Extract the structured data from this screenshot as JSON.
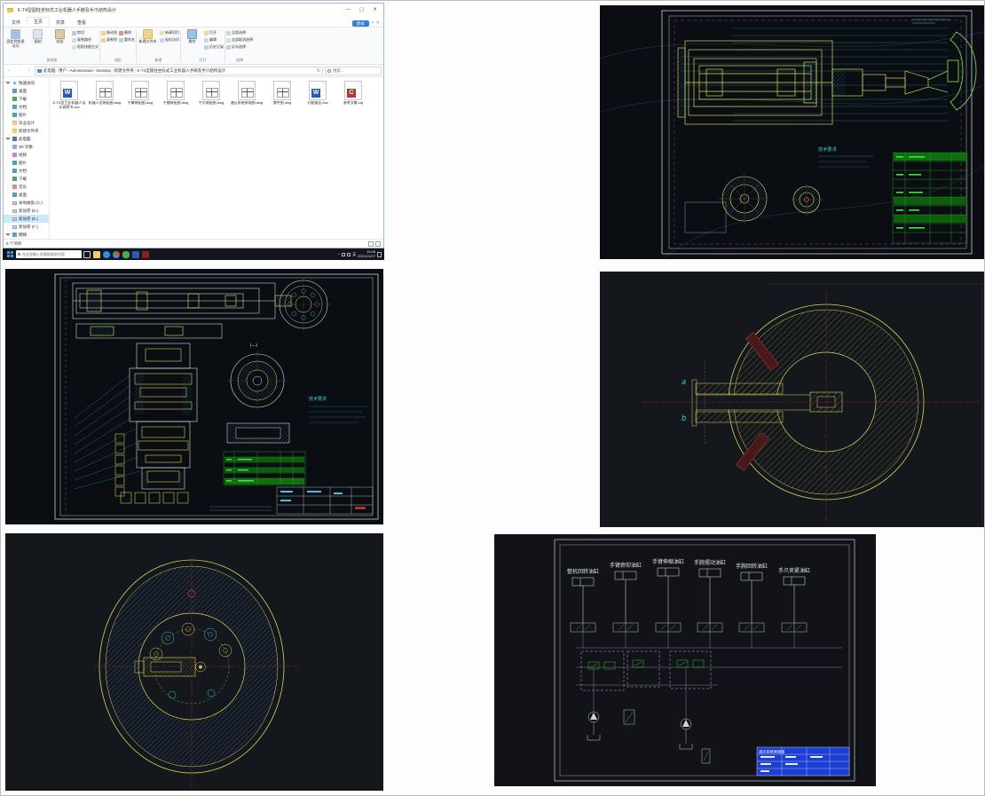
{
  "explorer": {
    "title": "K-T4型圆柱坐标式工业机器人手腕及手爪结构设计",
    "window_buttons": [
      "—",
      "▢",
      "✕"
    ],
    "tabs": [
      "文件",
      "主页",
      "共享",
      "查看"
    ],
    "login_badge": "登录",
    "help_label": "?",
    "ribbon": {
      "groups": [
        {
          "label": "剪贴板",
          "buttons": [
            "固定到快速访问",
            "复制",
            "粘贴",
            "剪切",
            "复制路径",
            "粘贴快捷方式"
          ]
        },
        {
          "label": "组织",
          "buttons": [
            "移动到",
            "复制到",
            "删除",
            "重命名"
          ]
        },
        {
          "label": "新建",
          "buttons": [
            "新建文件夹",
            "新建项目",
            "轻松访问"
          ]
        },
        {
          "label": "打开",
          "buttons": [
            "属性",
            "打开",
            "编辑",
            "历史记录"
          ]
        },
        {
          "label": "选择",
          "buttons": [
            "全部选择",
            "全部取消选择",
            "反向选择"
          ]
        }
      ]
    },
    "address": {
      "segments": [
        "此电脑",
        "用户",
        "Administrator",
        "Desktop",
        "新建文件夹",
        "K-T4型圆柱坐标式工业机器人手腕及手爪结构设计"
      ],
      "search_placeholder": "搜索..."
    },
    "sidebar": {
      "sections": [
        {
          "label": "快速访问",
          "items": [
            "桌面",
            "下载",
            "文档",
            "图片",
            "毕业设计",
            "新建文件夹"
          ]
        },
        {
          "label": "此电脑",
          "items": [
            "3D 对象",
            "视频",
            "图片",
            "文档",
            "下载",
            "音乐",
            "桌面",
            "本地磁盘 (C:)",
            "新加卷 (D:)",
            "新加卷 (E:)",
            "新加卷 (F:)"
          ]
        },
        {
          "label": "网络",
          "items": []
        }
      ]
    },
    "files": {
      "items": [
        {
          "name": "K-T4型工业机器人设计说明书.doc",
          "type": "word"
        },
        {
          "name": "机器人总装配图.dwg",
          "type": "dwg"
        },
        {
          "name": "手臂装配图.dwg",
          "type": "dwg"
        },
        {
          "name": "手腕装配图.dwg",
          "type": "dwg"
        },
        {
          "name": "手爪装配图.dwg",
          "type": "dwg"
        },
        {
          "name": "液压系统原理图.dwg",
          "type": "dwg"
        },
        {
          "name": "零件图.dwg",
          "type": "dwg"
        },
        {
          "name": "开题报告.doc",
          "type": "word"
        },
        {
          "name": "参考文献.caj",
          "type": "caj"
        }
      ],
      "status": "9 个项目"
    },
    "taskbar": {
      "search_placeholder": "在这里输入你要搜索的内容",
      "tray": {
        "lang": "英",
        "time": "10:08",
        "date": "2021/11/27"
      }
    }
  },
  "cad": {
    "panel1": {
      "note_title": "技术要求"
    },
    "panel2": {
      "note_title": "技术要求",
      "section_label": "I—I"
    },
    "panel3": {
      "label_a": "a",
      "label_b": "b"
    },
    "panel5": {
      "cylinder_labels": [
        "整机回转油缸",
        "手臂俯仰油缸",
        "手臂伸缩油缸",
        "手腕摆动油缸",
        "手腕回转油缸",
        "手爪夹紧油缸"
      ],
      "title_block": "液压系统原理图"
    }
  }
}
